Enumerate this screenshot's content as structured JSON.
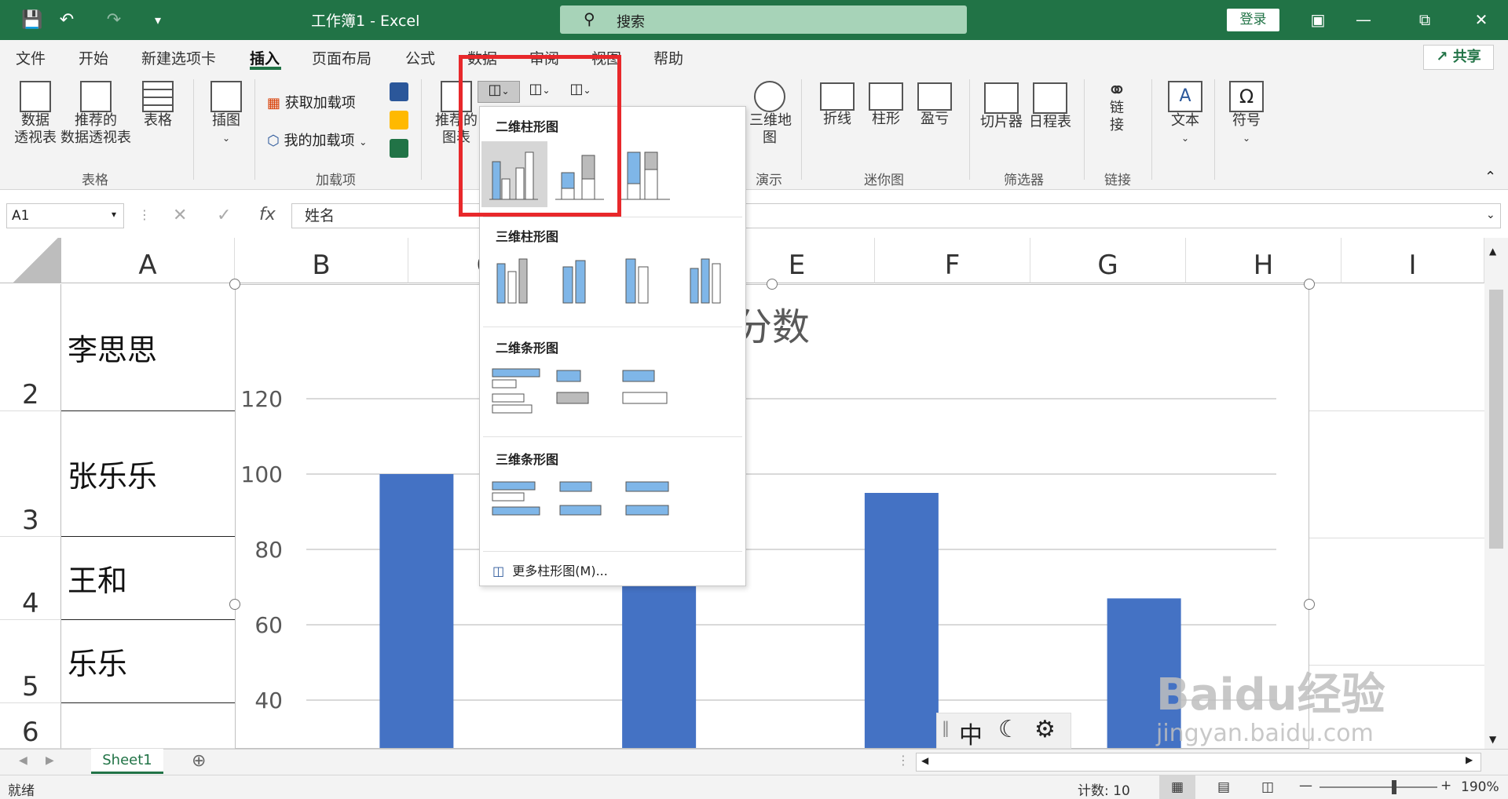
{
  "titlebar": {
    "doc_title": "工作簿1  -  Excel",
    "search_placeholder": "搜索",
    "login_label": "登录"
  },
  "menu": {
    "tabs": [
      "文件",
      "开始",
      "新建选项卡",
      "插入",
      "页面布局",
      "公式",
      "数据",
      "审阅",
      "视图",
      "帮助"
    ],
    "active_tab": "插入",
    "share_label": "共享"
  },
  "ribbon": {
    "pivot_table": "数据\n透视表",
    "recommended_pivot": "推荐的\n数据透视表",
    "table": "表格",
    "group_tables": "表格",
    "illustrations": "插图",
    "get_addins": "获取加载项",
    "my_addins": "我的加载项",
    "group_addins": "加载项",
    "recommended_charts": "推荐的\n图表",
    "map_3d": "三维地\n图",
    "group_tours": "演示",
    "spark_line": "折线",
    "spark_column": "柱形",
    "spark_winloss": "盈亏",
    "group_sparklines": "迷你图",
    "slicer": "切片器",
    "timeline": "日程表",
    "group_filters": "筛选器",
    "link": "链\n接",
    "group_links": "链接",
    "text": "文本",
    "symbol": "符号"
  },
  "formula_bar": {
    "name_box": "A1",
    "formula": "姓名"
  },
  "grid": {
    "columns": [
      "A",
      "B",
      "C",
      "D",
      "E",
      "F",
      "G",
      "H",
      "I"
    ],
    "rows": [
      {
        "num": "2",
        "a": "李思思"
      },
      {
        "num": "3",
        "a": "张乐乐"
      },
      {
        "num": "4",
        "a": "王和"
      },
      {
        "num": "5",
        "a": "乐乐"
      },
      {
        "num": "6",
        "a": ""
      }
    ]
  },
  "chart_data": {
    "type": "bar",
    "title": "分数",
    "y_ticks": [
      40,
      60,
      80,
      100,
      120
    ],
    "categories": [
      "李思思",
      "张乐乐",
      "王和",
      "乐乐"
    ],
    "values": [
      100,
      72,
      95,
      67
    ],
    "ylim": [
      0,
      120
    ],
    "grid": true,
    "color": "#4472c4"
  },
  "dropdown": {
    "section_2d_column": "二维柱形图",
    "section_3d_column": "三维柱形图",
    "section_2d_bar": "二维条形图",
    "section_3d_bar": "三维条形图",
    "more_label": "更多柱形图(M)..."
  },
  "ime": {
    "mode": "中"
  },
  "watermark": {
    "line1": "Baidu经验",
    "line2": "jingyan.baidu.com"
  },
  "sheets": {
    "active": "Sheet1"
  },
  "status": {
    "ready": "就绪",
    "count": "计数: 10",
    "zoom": "190%"
  },
  "colors": {
    "excel_green": "#217346",
    "highlight_red": "#e8282b",
    "bar_blue": "#4472c4"
  }
}
